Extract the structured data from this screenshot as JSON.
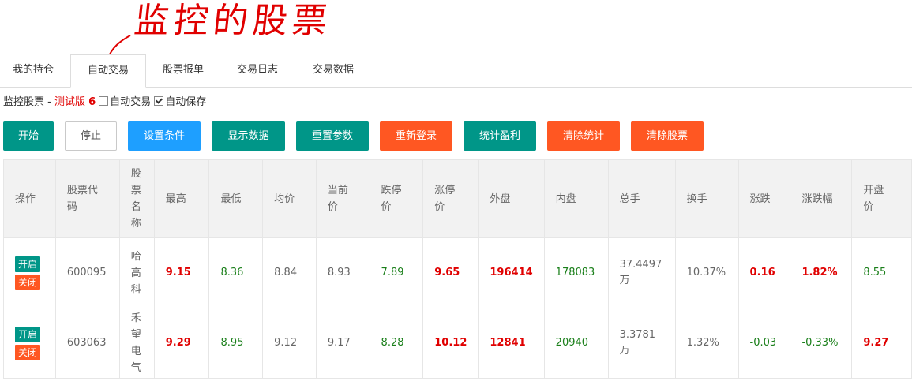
{
  "annotation": "监控的股票",
  "tabs": [
    "我的持仓",
    "自动交易",
    "股票报单",
    "交易日志",
    "交易数据"
  ],
  "status": {
    "label": "监控股票 - ",
    "test_label": "测试版",
    "version": "6",
    "auto_trade_label": "自动交易",
    "auto_save_label": "自动保存"
  },
  "buttons": [
    "开始",
    "停止",
    "设置条件",
    "显示数据",
    "重置参数",
    "重新登录",
    "统计盈利",
    "清除统计",
    "清除股票"
  ],
  "table": {
    "headers": [
      "操作",
      "股票代码",
      "股票名称",
      "最高",
      "最低",
      "均价",
      "当前价",
      "跌停价",
      "涨停价",
      "外盘",
      "内盘",
      "总手",
      "换手",
      "涨跌",
      "涨跌幅",
      "开盘价"
    ],
    "action_labels": {
      "open": "开启",
      "close": "关闭"
    },
    "rows": [
      {
        "code": "600095",
        "name": "哈高科",
        "high": "9.15",
        "low": "8.36",
        "avg": "8.84",
        "current": "8.93",
        "limit_down": "7.89",
        "limit_up": "9.65",
        "outer": "196414",
        "inner": "178083",
        "volume": "37.4497万",
        "turnover": "10.37%",
        "change": "0.16",
        "change_pct": "1.82%",
        "open": "8.55"
      },
      {
        "code": "603063",
        "name": "禾望电气",
        "high": "9.29",
        "low": "8.95",
        "avg": "9.12",
        "current": "9.17",
        "limit_down": "8.28",
        "limit_up": "10.12",
        "outer": "12841",
        "inner": "20940",
        "volume": "3.3781万",
        "turnover": "1.32%",
        "change": "-0.03",
        "change_pct": "-0.33%",
        "open": "9.27"
      }
    ]
  },
  "colors": {
    "teal": "#009688",
    "blue": "#1e9fff",
    "orange": "#ff5722",
    "red": "#e00000",
    "green": "#1a7f1a"
  }
}
